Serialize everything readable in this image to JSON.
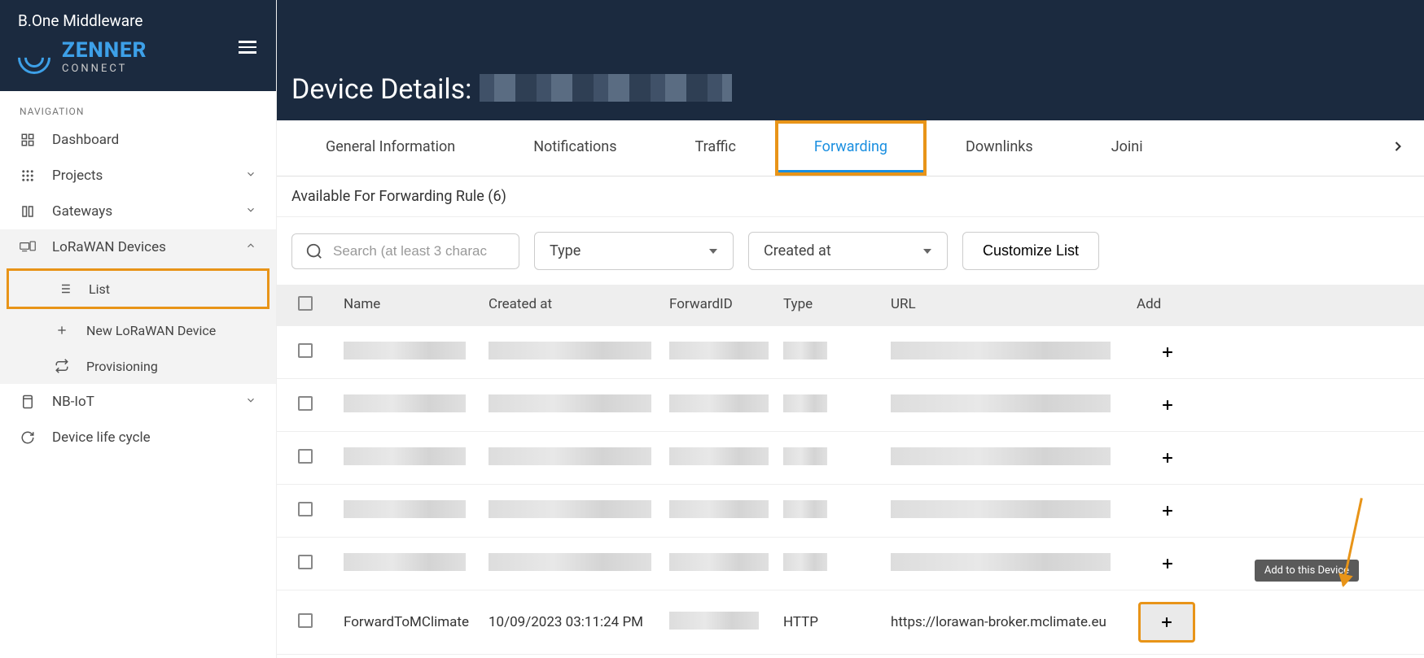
{
  "app": {
    "title": "B.One Middleware"
  },
  "brand": {
    "name": "ZENNER",
    "sub": "CONNECT"
  },
  "nav": {
    "section": "NAVIGATION",
    "items": [
      {
        "label": "Dashboard"
      },
      {
        "label": "Projects"
      },
      {
        "label": "Gateways"
      },
      {
        "label": "LoRaWAN Devices"
      },
      {
        "label": "NB-IoT"
      },
      {
        "label": "Device life cycle"
      }
    ],
    "lorawan_sub": [
      {
        "label": "List"
      },
      {
        "label": "New LoRaWAN Device"
      },
      {
        "label": "Provisioning"
      }
    ]
  },
  "page": {
    "title_prefix": "Device Details:"
  },
  "tabs": [
    "General Information",
    "Notifications",
    "Traffic",
    "Forwarding",
    "Downlinks",
    "Joini"
  ],
  "section": {
    "label": "Available For Forwarding Rule (6)"
  },
  "toolbar": {
    "search_placeholder": "Search (at least 3 charac",
    "type_label": "Type",
    "created_label": "Created at",
    "customize_label": "Customize List"
  },
  "table": {
    "headers": {
      "name": "Name",
      "created": "Created at",
      "forward": "ForwardID",
      "type": "Type",
      "url": "URL",
      "add": "Add"
    },
    "last_row": {
      "name": "ForwardToMClimate",
      "created": "10/09/2023 03:11:24 PM",
      "type": "HTTP",
      "url": "https://lorawan-broker.mclimate.eu"
    }
  },
  "tooltip": {
    "text": "Add to this Device"
  }
}
